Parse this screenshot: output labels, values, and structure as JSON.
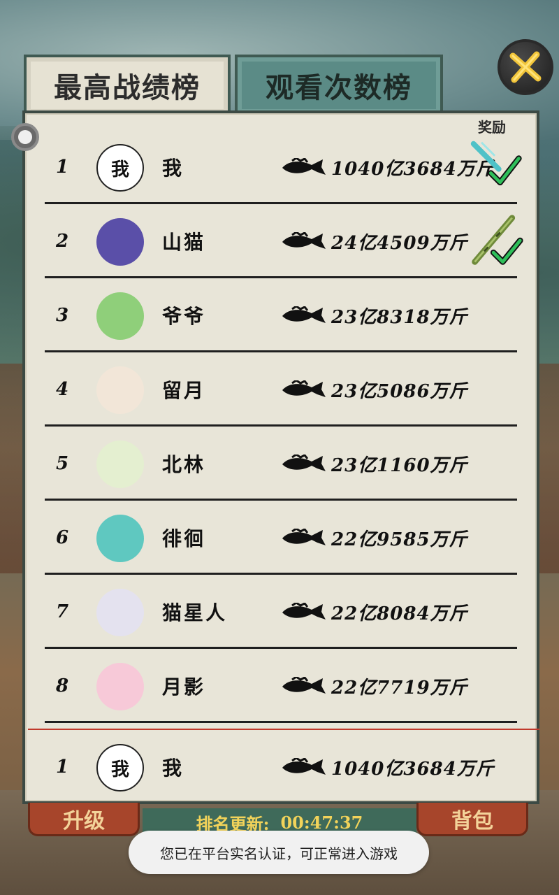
{
  "tabs": {
    "active_label": "最高战绩榜",
    "inactive_label": "观看次数榜"
  },
  "panel": {
    "reward_header": "奖励"
  },
  "leaderboard": [
    {
      "rank": "1",
      "avatar": "我",
      "name": "我",
      "score": "1040亿3684万斤",
      "reward": "jade-sword-icon"
    },
    {
      "rank": "2",
      "avatar": "",
      "name": "山猫",
      "score": "24亿4509万斤",
      "reward": "bamboo-rod-icon"
    },
    {
      "rank": "3",
      "avatar": "",
      "name": "爷爷",
      "score": "23亿8318万斤"
    },
    {
      "rank": "4",
      "avatar": "",
      "name": "留月",
      "score": "23亿5086万斤"
    },
    {
      "rank": "5",
      "avatar": "",
      "name": "北林",
      "score": "23亿1160万斤"
    },
    {
      "rank": "6",
      "avatar": "",
      "name": "徘徊",
      "score": "22亿9585万斤"
    },
    {
      "rank": "7",
      "avatar": "",
      "name": "猫星人",
      "score": "22亿8084万斤"
    },
    {
      "rank": "8",
      "avatar": "",
      "name": "月影",
      "score": "22亿7719万斤"
    }
  ],
  "self_row": {
    "rank": "1",
    "avatar": "我",
    "name": "我",
    "score": "1040亿3684万斤"
  },
  "bottom": {
    "left_button": "升级",
    "right_button": "背包",
    "refresh_label": "排名更新:",
    "refresh_time": "00:47:37"
  },
  "toast": "您已在平台实名认证，可正常进入游戏",
  "colors": {
    "panel_bg": "#e8e5d8",
    "active_tab": "#e6e2d3",
    "inactive_tab": "#5b8b86",
    "check": "#2fbf5a",
    "divider_self": "#c0392b"
  }
}
